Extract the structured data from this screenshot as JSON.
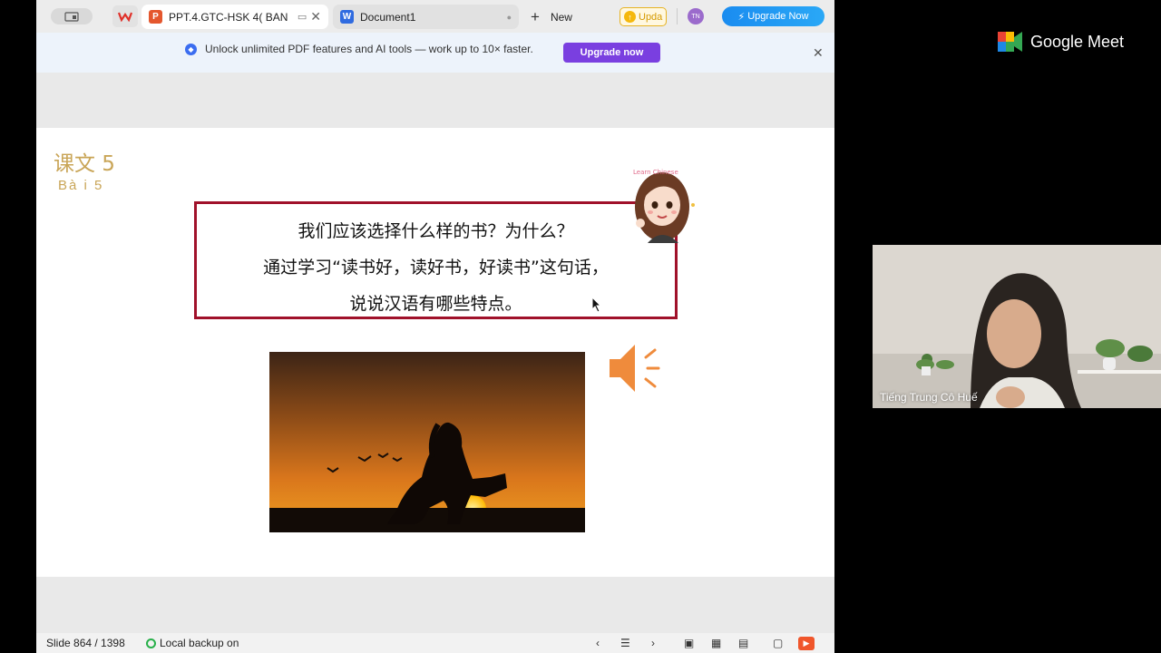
{
  "tabbar": {
    "tab_ppt": "PPT.4.GTC-HSK 4( BAN",
    "tab_doc": "Document1",
    "new_label": "New",
    "upda_label": "Upda",
    "avatar_initials": "TN",
    "upgrade_label": "Upgrade Now"
  },
  "banner": {
    "text": "Unlock unlimited PDF features and AI tools — work up to 10× faster.",
    "button": "Upgrade now"
  },
  "slide": {
    "lesson_cn": "课文 5",
    "lesson_vn": "Bà i 5",
    "question_lines": [
      "我们应该选择什么样的书？为什么？",
      "通过学习“读书好，读好书，好读书”这句话，",
      "说说汉语有哪些特点。"
    ],
    "sticker_text": "Learn Chinese"
  },
  "statusbar": {
    "slide_count": "Slide 864 / 1398",
    "backup": "Local backup on"
  },
  "meet": {
    "logo_text": "Google Meet",
    "participant_name": "Tiếng Trung Cô Huế"
  },
  "colors": {
    "accent_red": "#a0112a",
    "gold": "#c9a557",
    "purple": "#7a3fe0",
    "blue": "#1a8cf0"
  }
}
